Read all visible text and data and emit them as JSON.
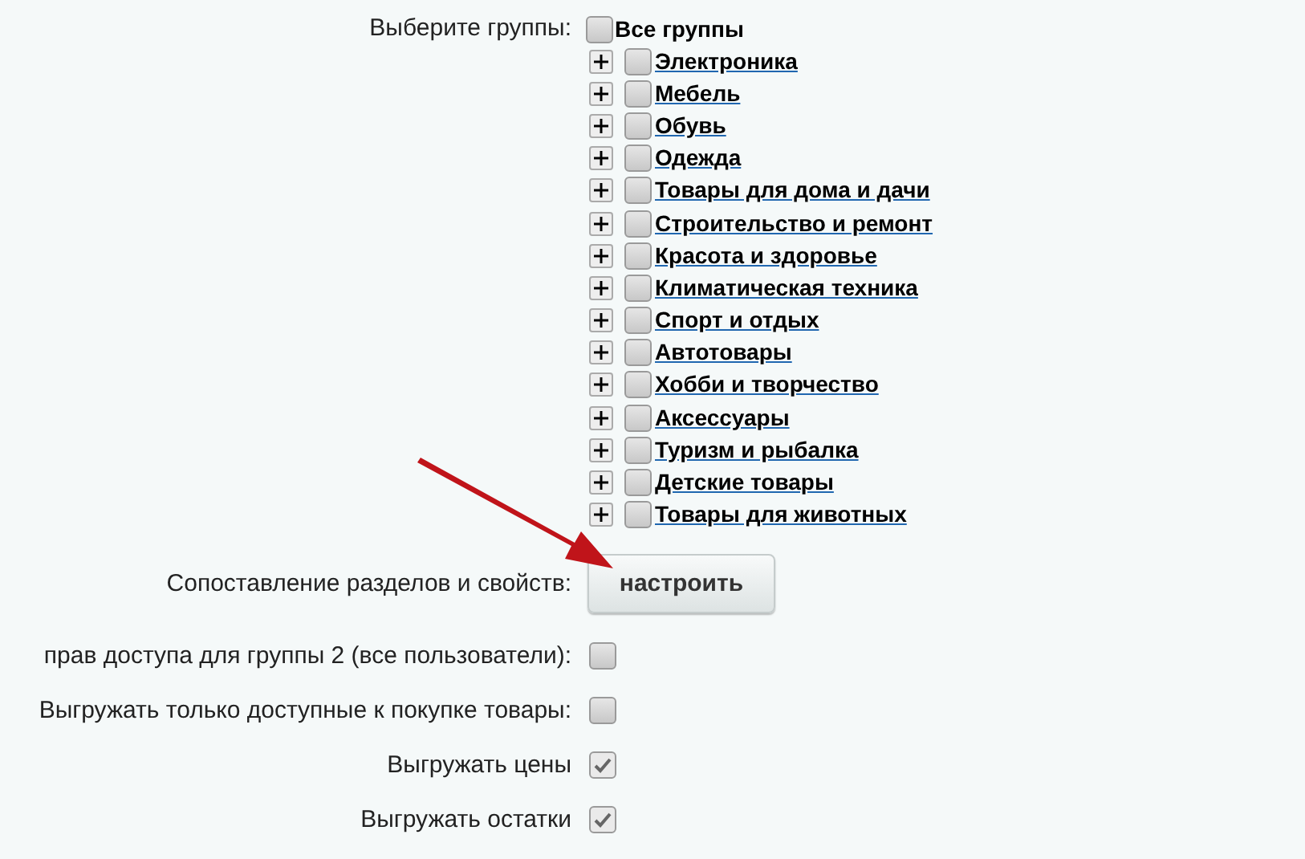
{
  "groups": {
    "label": "Выберите группы:",
    "all": {
      "label": "Все группы",
      "checked": false
    },
    "categories": [
      {
        "label": "Электроника",
        "checked": false,
        "expanded": false
      },
      {
        "label": "Мебель",
        "checked": false,
        "expanded": false
      },
      {
        "label": "Обувь",
        "checked": false,
        "expanded": false
      },
      {
        "label": "Одежда",
        "checked": false,
        "expanded": false
      },
      {
        "label": "Товары для дома и дачи",
        "checked": false,
        "expanded": false
      },
      {
        "label": "Строительство и ремонт",
        "checked": false,
        "expanded": false
      },
      {
        "label": "Красота и здоровье",
        "checked": false,
        "expanded": false
      },
      {
        "label": "Климатическая техника",
        "checked": false,
        "expanded": false
      },
      {
        "label": "Спорт и отдых",
        "checked": false,
        "expanded": false
      },
      {
        "label": "Автотовары",
        "checked": false,
        "expanded": false
      },
      {
        "label": "Хобби и творчество",
        "checked": false,
        "expanded": false
      },
      {
        "label": "Аксессуары",
        "checked": false,
        "expanded": false
      },
      {
        "label": "Туризм и рыбалка",
        "checked": false,
        "expanded": false
      },
      {
        "label": "Детские товары",
        "checked": false,
        "expanded": false
      },
      {
        "label": "Товары для животных",
        "checked": false,
        "expanded": false
      }
    ]
  },
  "mapping": {
    "label": "Сопоставление разделов и свойств:",
    "button": "настроить"
  },
  "options": [
    {
      "label": "прав доступа для группы 2 (все пользователи):",
      "checked": false
    },
    {
      "label": "Выгружать только доступные к покупке товары:",
      "checked": false
    },
    {
      "label": "Выгружать цены",
      "checked": true
    },
    {
      "label": "Выгружать остатки",
      "checked": true
    }
  ]
}
